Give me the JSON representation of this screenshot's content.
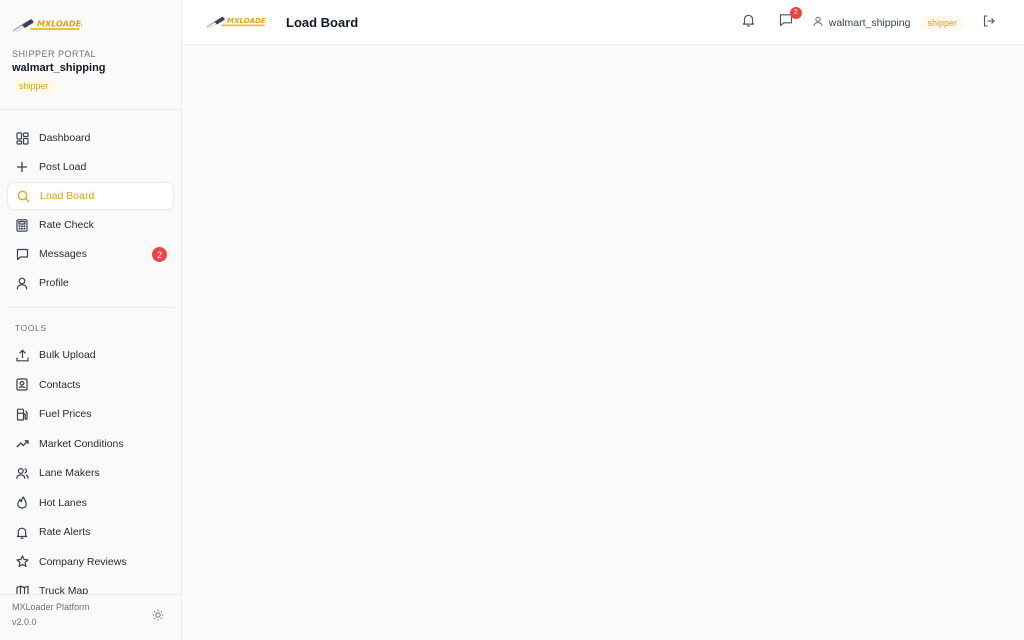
{
  "brand": {
    "logo_text": "MXLOADER",
    "accent": "#e0a216"
  },
  "sidebar": {
    "portal_label": "SHIPPER PORTAL",
    "username": "walmart_shipping",
    "role": "shipper",
    "nav": [
      {
        "label": "Dashboard",
        "icon": "dashboard-icon"
      },
      {
        "label": "Post Load",
        "icon": "plus-icon"
      },
      {
        "label": "Load Board",
        "icon": "search-icon",
        "active": true
      },
      {
        "label": "Rate Check",
        "icon": "calculator-icon"
      },
      {
        "label": "Messages",
        "icon": "message-icon",
        "count": "2"
      },
      {
        "label": "Profile",
        "icon": "user-icon"
      }
    ],
    "tools_label": "TOOLS",
    "tools": [
      {
        "label": "Bulk Upload",
        "icon": "upload-icon"
      },
      {
        "label": "Contacts",
        "icon": "contacts-icon"
      },
      {
        "label": "Fuel Prices",
        "icon": "fuel-icon"
      },
      {
        "label": "Market Conditions",
        "icon": "trending-up-icon"
      },
      {
        "label": "Lane Makers",
        "icon": "users-icon"
      },
      {
        "label": "Hot Lanes",
        "icon": "flame-icon"
      },
      {
        "label": "Rate Alerts",
        "icon": "bell-icon"
      },
      {
        "label": "Company Reviews",
        "icon": "star-icon"
      },
      {
        "label": "Truck Map",
        "icon": "map-icon"
      }
    ],
    "footer": {
      "platform": "MXLoader Platform",
      "version": "v2.0.0"
    }
  },
  "topbar": {
    "title": "Load Board",
    "messages_count": "2",
    "username": "walmart_shipping",
    "role": "shipper"
  }
}
